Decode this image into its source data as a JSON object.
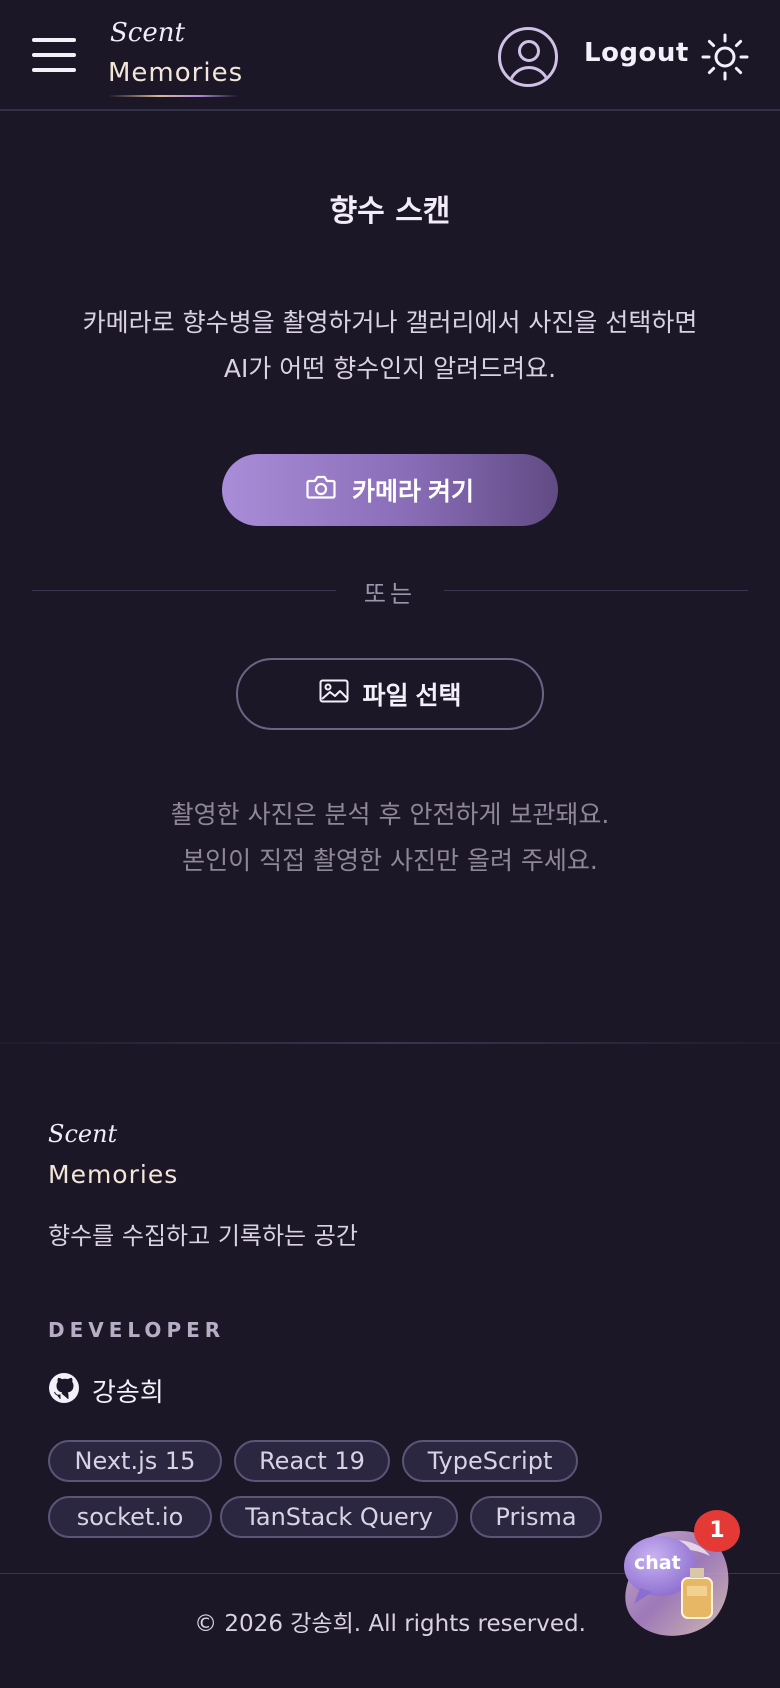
{
  "header": {
    "logo_script": "Scent",
    "logo_name": "Memories",
    "logout_label": "Logout",
    "icons": {
      "menu": "hamburger-menu-icon",
      "profile": "user-circle-icon",
      "theme": "sun-icon"
    }
  },
  "main": {
    "title": "향수 스캔",
    "description_line1": "카메라로 향수병을 촬영하거나 갤러리에서 사진을 선택하면",
    "description_line2": "AI가 어떤 향수인지 알려드려요.",
    "camera_button_label": "카메라 켜기",
    "divider_text": "또는",
    "file_button_label": "파일 선택",
    "note_line1": "촬영한 사진은 분석 후 안전하게 보관돼요.",
    "note_line2": "본인이 직접 촬영한 사진만 올려 주세요.",
    "colors": {
      "accent_start": "#a98dd8",
      "accent_end": "#614b84",
      "background": "#1b1726"
    }
  },
  "footer": {
    "logo_script": "Scent",
    "logo_name": "Memories",
    "tagline": "향수를 수집하고 기록하는 공간",
    "developer_label": "DEVELOPER",
    "developer_name": "강송희",
    "tech_stack": [
      "Next.js 15",
      "React 19",
      "TypeScript",
      "socket.io",
      "TanStack Query",
      "Prisma"
    ],
    "copyright": "© 2026 강송희. All rights reserved."
  },
  "chat": {
    "label": "chat",
    "badge_count": "1"
  }
}
